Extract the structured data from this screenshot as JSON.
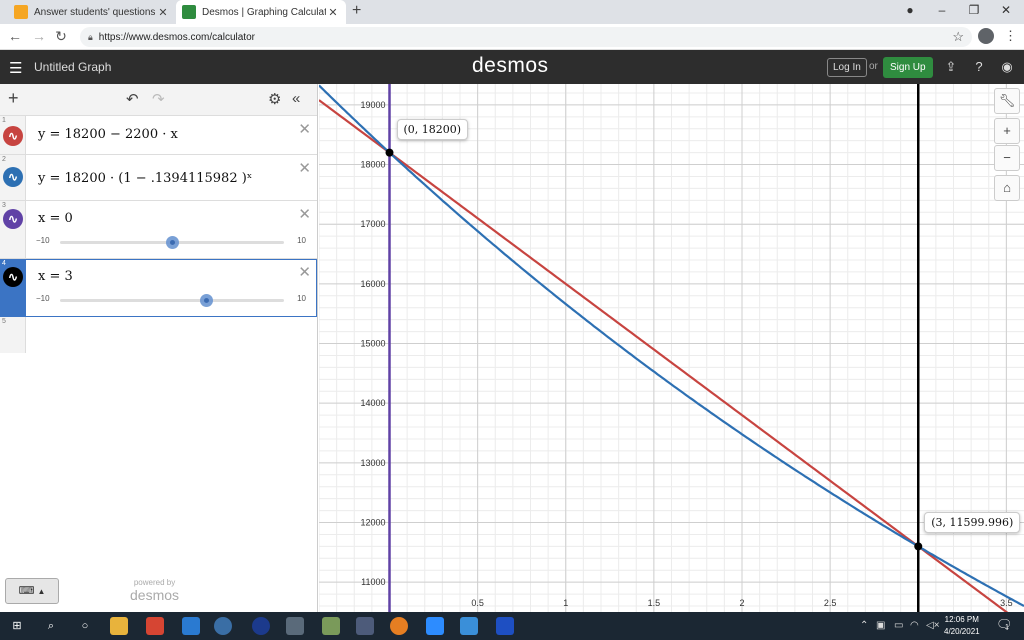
{
  "browser": {
    "tabs": [
      {
        "label": "Answer students' questions and e",
        "active": false
      },
      {
        "label": "Desmos | Graphing Calculator",
        "active": true
      }
    ],
    "url": "https://www.desmos.com/calculator"
  },
  "header": {
    "graph_title": "Untitled Graph",
    "logo": "desmos",
    "login": "Log In",
    "or": "or",
    "signup": "Sign Up"
  },
  "expressions": [
    {
      "index": "1",
      "latex": "y = 18200 − 2200 · x",
      "color": "#c74440",
      "icon": "sine-wave-icon"
    },
    {
      "index": "2",
      "latex": "y = 18200 · (1 − .1394115982 )ˣ",
      "color": "#2d70b3",
      "icon": "sine-wave-icon"
    },
    {
      "index": "3",
      "latex": "x = 0",
      "color": "#6042a6",
      "icon": "sine-wave-icon",
      "slider": {
        "min": "−10",
        "max": "10",
        "value": 0
      }
    },
    {
      "index": "4",
      "latex": "x = 3",
      "color": "#000000",
      "icon": "sine-wave-icon",
      "slider": {
        "min": "−10",
        "max": "10",
        "value": 3
      }
    },
    {
      "index": "5",
      "latex": ""
    }
  ],
  "powered_by": {
    "line1": "powered by",
    "line2": "desmos"
  },
  "graph": {
    "point_labels": [
      {
        "text": "(0, 18200)",
        "x": 0,
        "y": 18200
      },
      {
        "text": "(3, 11599.996)",
        "x": 3,
        "y": 11599.996
      }
    ]
  },
  "chart_data": {
    "type": "line",
    "xlim": [
      -0.4,
      3.6
    ],
    "ylim": [
      10500,
      19350
    ],
    "x_ticks": [
      0.5,
      1,
      1.5,
      2,
      2.5,
      3,
      3.5
    ],
    "x_tick_labels": [
      "0.5",
      "1",
      "1.5",
      "2",
      "2.5",
      "",
      "3.5"
    ],
    "y_ticks": [
      11000,
      12000,
      13000,
      14000,
      15000,
      16000,
      17000,
      18000,
      19000
    ],
    "y_tick_labels": [
      "11000",
      "12000",
      "13000",
      "14000",
      "15000",
      "16000",
      "17000",
      "18000",
      "19000"
    ],
    "grid": true,
    "series": [
      {
        "expr": "y = 18200 − 2200x",
        "kind": "linear",
        "a": 18200,
        "b": -2200,
        "color": "#c74440"
      },
      {
        "expr": "y = 18200(1 − .1394115982)^x",
        "kind": "exponential",
        "a": 18200,
        "r": 0.8605884018,
        "color": "#2d70b3"
      },
      {
        "expr": "x = 0",
        "kind": "vertical",
        "x": 0,
        "color": "#6042a6"
      },
      {
        "expr": "x = 3",
        "kind": "vertical",
        "x": 3,
        "color": "#000000"
      }
    ],
    "points": [
      {
        "x": 0,
        "y": 18200
      },
      {
        "x": 3,
        "y": 11599.996
      }
    ]
  },
  "taskbar": {
    "time": "12:06 PM",
    "date": "4/20/2021",
    "notifications": "1"
  }
}
